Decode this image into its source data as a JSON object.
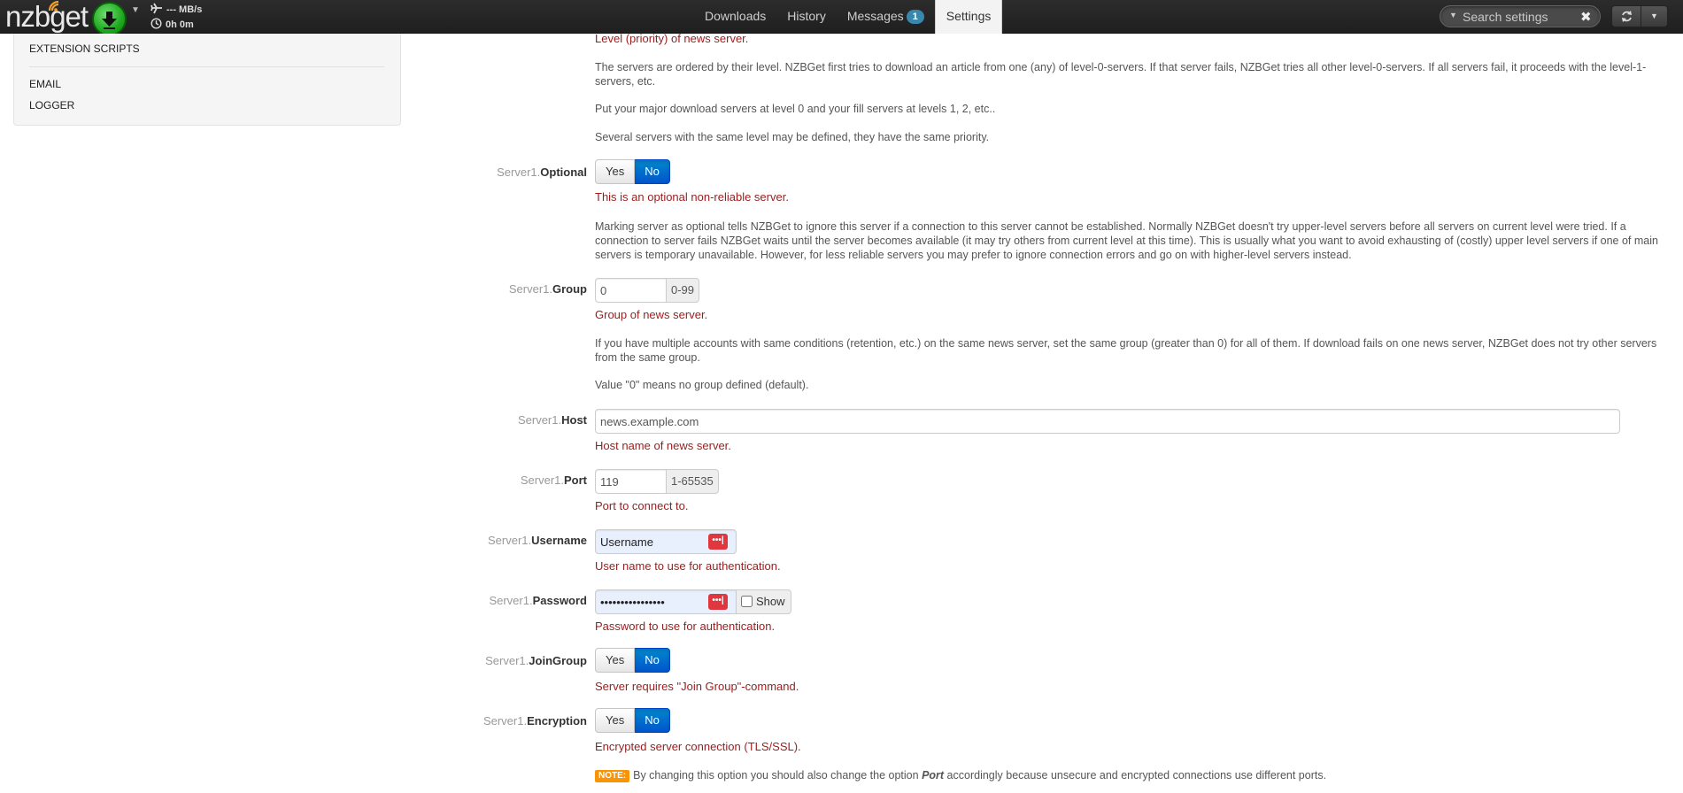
{
  "navbar": {
    "logo_text": "nzbget",
    "speed_text": "--- MB/s",
    "time_text": "0h 0m",
    "tabs": [
      {
        "label": "Downloads"
      },
      {
        "label": "History"
      },
      {
        "label": "Messages",
        "badge": "1"
      },
      {
        "label": "Settings",
        "active": true
      }
    ],
    "search_placeholder": "Search settings"
  },
  "sidebar": {
    "items": [
      {
        "label": "EXTENSION SCRIPTS"
      },
      {
        "label": "EMAIL"
      },
      {
        "label": "LOGGER"
      }
    ]
  },
  "options": {
    "level": {
      "help_red": "Level (priority) of news server.",
      "help1": "The servers are ordered by their level. NZBGet first tries to download an article from one (any) of level-0-servers. If that server fails, NZBGet tries all other level-0-servers. If all servers fail, it proceeds with the level-1-servers, etc.",
      "help2": "Put your major download servers at level 0 and your fill servers at levels 1, 2, etc..",
      "help3": "Several servers with the same level may be defined, they have the same priority."
    },
    "optional": {
      "prefix": "Server1.",
      "name": "Optional",
      "yes": "Yes",
      "no": "No",
      "help_red": "This is an optional non-reliable server.",
      "help1": "Marking server as optional tells NZBGet to ignore this server if a connection to this server cannot be established. Normally NZBGet doesn't try upper-level servers before all servers on current level were tried. If a connection to server fails NZBGet waits until the server becomes available (it may try others from current level at this time). This is usually what you want to avoid exhausting of (costly) upper level servers if one of main servers is temporary unavailable. However, for less reliable servers you may prefer to ignore connection errors and go on with higher-level servers instead."
    },
    "group": {
      "prefix": "Server1.",
      "name": "Group",
      "value": "0",
      "range": "0-99",
      "help_red": "Group of news server.",
      "help1": "If you have multiple accounts with same conditions (retention, etc.) on the same news server, set the same group (greater than 0) for all of them. If download fails on one news server, NZBGet does not try other servers from the same group.",
      "help2": "Value \"0\" means no group defined (default)."
    },
    "host": {
      "prefix": "Server1.",
      "name": "Host",
      "value": "news.example.com",
      "help_red": "Host name of news server."
    },
    "port": {
      "prefix": "Server1.",
      "name": "Port",
      "value": "119",
      "range": "1-65535",
      "help_red": "Port to connect to."
    },
    "username": {
      "prefix": "Server1.",
      "name": "Username",
      "value": "Username",
      "help_red": "User name to use for authentication."
    },
    "password": {
      "prefix": "Server1.",
      "name": "Password",
      "value": "••••••••••••••••",
      "show_label": "Show",
      "help_red": "Password to use for authentication."
    },
    "joingroup": {
      "prefix": "Server1.",
      "name": "JoinGroup",
      "yes": "Yes",
      "no": "No",
      "help_red": "Server requires \"Join Group\"-command."
    },
    "encryption": {
      "prefix": "Server1.",
      "name": "Encryption",
      "yes": "Yes",
      "no": "No",
      "help_red": "Encrypted server connection (TLS/SSL).",
      "note_tag": "NOTE:",
      "note_before": "By changing this option you should also change the option",
      "note_em": "Port",
      "note_after": "accordingly because unsecure and encrypted connections use different ports."
    }
  },
  "colors": {
    "navbar": "#222222",
    "toggle_on": "#0066cc",
    "help_red": "#9b1c1c",
    "badge": "#3a87ad",
    "note": "#f89406",
    "password_manager_icon": "#e0373f"
  }
}
